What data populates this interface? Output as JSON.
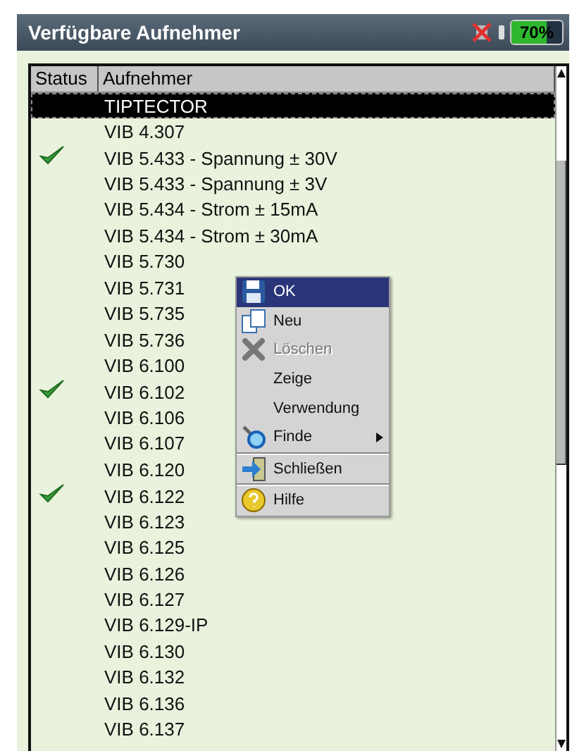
{
  "window": {
    "title": "Verfügbare Aufnehmer"
  },
  "battery": {
    "label": "70%",
    "level": 0.7
  },
  "table": {
    "columns": [
      "Status",
      "Aufnehmer"
    ],
    "rows": [
      {
        "name": "TIPTECTOR",
        "checked": false,
        "selected": true
      },
      {
        "name": "VIB 4.307",
        "checked": false,
        "selected": false
      },
      {
        "name": "VIB 5.433 - Spannung ± 30V",
        "checked": true,
        "selected": false
      },
      {
        "name": "VIB 5.433 - Spannung ± 3V",
        "checked": false,
        "selected": false
      },
      {
        "name": "VIB 5.434 - Strom ± 15mA",
        "checked": false,
        "selected": false
      },
      {
        "name": "VIB 5.434 - Strom ± 30mA",
        "checked": false,
        "selected": false
      },
      {
        "name": "VIB 5.730",
        "checked": false,
        "selected": false
      },
      {
        "name": "VIB 5.731",
        "checked": false,
        "selected": false
      },
      {
        "name": "VIB 5.735",
        "checked": false,
        "selected": false
      },
      {
        "name": "VIB 5.736",
        "checked": false,
        "selected": false
      },
      {
        "name": "VIB 6.100",
        "checked": false,
        "selected": false
      },
      {
        "name": "VIB 6.102",
        "checked": true,
        "selected": false
      },
      {
        "name": "VIB 6.106",
        "checked": false,
        "selected": false
      },
      {
        "name": "VIB 6.107",
        "checked": false,
        "selected": false
      },
      {
        "name": "VIB 6.120",
        "checked": false,
        "selected": false
      },
      {
        "name": "VIB 6.122",
        "checked": true,
        "selected": false
      },
      {
        "name": "VIB 6.123",
        "checked": false,
        "selected": false
      },
      {
        "name": "VIB 6.125",
        "checked": false,
        "selected": false
      },
      {
        "name": "VIB 6.126",
        "checked": false,
        "selected": false
      },
      {
        "name": "VIB 6.127",
        "checked": false,
        "selected": false
      },
      {
        "name": "VIB 6.129-IP",
        "checked": false,
        "selected": false
      },
      {
        "name": "VIB 6.130",
        "checked": false,
        "selected": false
      },
      {
        "name": "VIB 6.132",
        "checked": false,
        "selected": false
      },
      {
        "name": "VIB 6.136",
        "checked": false,
        "selected": false
      },
      {
        "name": "VIB 6.137",
        "checked": false,
        "selected": false
      }
    ]
  },
  "context_menu": {
    "items": [
      {
        "kind": "item",
        "label": "OK",
        "selected": true,
        "disabled": false
      },
      {
        "kind": "item",
        "label": "Neu",
        "selected": false,
        "disabled": false
      },
      {
        "kind": "item",
        "label": "Löschen",
        "selected": false,
        "disabled": true
      },
      {
        "kind": "item",
        "label": "Zeige",
        "selected": false,
        "disabled": false
      },
      {
        "kind": "item",
        "label": "Verwendung",
        "selected": false,
        "disabled": false
      },
      {
        "kind": "item",
        "label": "Finde",
        "submenu": true,
        "selected": false,
        "disabled": false
      },
      {
        "kind": "separator"
      },
      {
        "kind": "item",
        "label": "Schließen",
        "selected": false,
        "disabled": false
      },
      {
        "kind": "separator"
      },
      {
        "kind": "item",
        "label": "Hilfe",
        "selected": false,
        "disabled": false
      }
    ]
  }
}
